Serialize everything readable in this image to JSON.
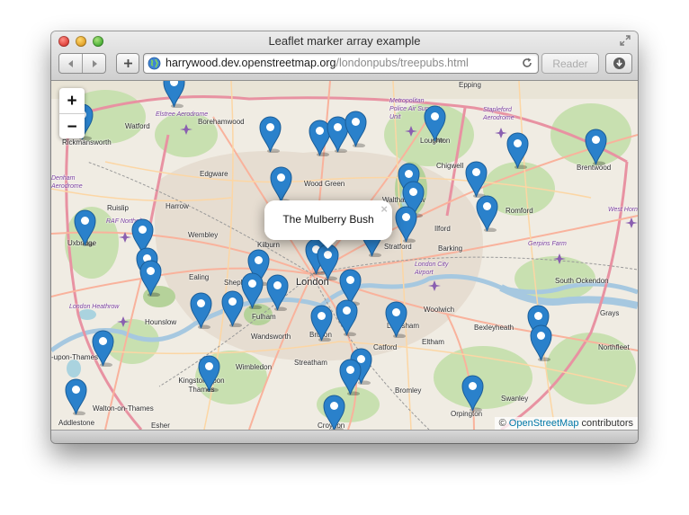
{
  "window": {
    "title": "Leaflet marker array example"
  },
  "toolbar": {
    "back_icon": "back-arrow-icon",
    "forward_icon": "forward-arrow-icon",
    "add_icon": "plus-icon",
    "reader_label": "Reader",
    "download_icon": "download-icon"
  },
  "url": {
    "host": "harrywood.dev.openstreetmap.org",
    "path": "/londonpubs/treepubs.html"
  },
  "map": {
    "zoom_in": "+",
    "zoom_out": "−",
    "popup": "The Mulberry Bush",
    "popup_close": "×",
    "attribution_prefix": "©",
    "attribution_link": "OpenStreetMap",
    "attribution_suffix": "contributors",
    "marker_color": "#2a81cb",
    "places": {
      "london": "London",
      "rickmansworth": "Rickmansworth",
      "watford": "Watford",
      "elstree": "Elstree Aerodrome",
      "borehamwood": "Borehamwood",
      "epping": "Epping",
      "metropolitan": "Metropolitan Police Air Support Unit",
      "stapleford": "Stapleford Aerodrome",
      "loughton": "Loughton",
      "chigwell": "Chigwell",
      "brentwood": "Brentwood",
      "denham": "Denham Aerodrome",
      "edgware": "Edgware",
      "wood_green": "Wood Green",
      "ruislip": "Ruislip",
      "harrow": "Harrow",
      "raf_northolt": "RAF Northolt",
      "romford": "Romford",
      "west_horndon": "West Horn",
      "uxbridge": "Uxbridge",
      "wembley": "Wembley",
      "walthamstow": "Walthamstow",
      "ilford": "Ilford",
      "kilburn": "Kilburn",
      "stratford": "Stratford",
      "barking": "Barking",
      "gerpins": "Gerpins Farm",
      "ealing": "Ealing",
      "london_city": "London City Airport",
      "south_ockendon": "South Ockendon",
      "heathrow": "London Heathrow",
      "woolwich": "Woolwich",
      "hounslow": "Hounslow",
      "fulham": "Fulham",
      "lewisham": "Lewisham",
      "grays": "Grays",
      "wandsworth": "Wandsworth",
      "brixton": "Brixton",
      "bexleyheath": "Bexleyheath",
      "catford": "Catford",
      "eltham": "Eltham",
      "northfleet": "Northfleet",
      "sunbury": "-upon-Thames",
      "wimbledon": "Wimbledon",
      "streatham": "Streatham",
      "kingston": "Kingston upon Thames",
      "bromley": "Bromley",
      "swanley": "Swanley",
      "walton": "Walton-on-Thames",
      "orpington": "Orpington",
      "addlestone": "Addlestone",
      "esher": "Esher",
      "croydon": "Croydon",
      "shepherds": "Sheph"
    }
  }
}
